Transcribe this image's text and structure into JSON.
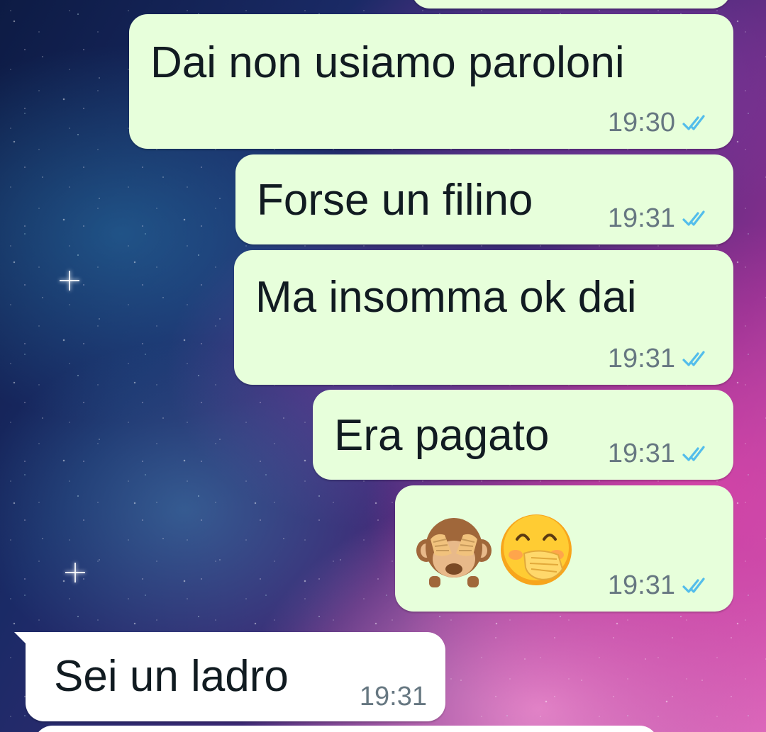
{
  "chat": {
    "messages": [
      {
        "text": "",
        "time": "",
        "direction": "outgoing"
      },
      {
        "text": "Dai non usiamo paroloni",
        "time": "19:30",
        "direction": "outgoing",
        "status": "read"
      },
      {
        "text": "Forse un filino",
        "time": "19:31",
        "direction": "outgoing",
        "status": "read"
      },
      {
        "text": "Ma insomma ok dai",
        "time": "19:31",
        "direction": "outgoing",
        "status": "read"
      },
      {
        "text": "Era pagato",
        "time": "19:31",
        "direction": "outgoing",
        "status": "read"
      },
      {
        "emojis": [
          "see-no-evil-monkey",
          "face-with-hand-over-mouth"
        ],
        "time": "19:31",
        "direction": "outgoing",
        "status": "read"
      },
      {
        "text": "Sei un ladro",
        "time": "19:31",
        "direction": "incoming"
      }
    ]
  },
  "colors": {
    "outgoing_bubble": "#e7ffdb",
    "incoming_bubble": "#ffffff",
    "read_ticks": "#53bdeb",
    "timestamp": "#667781",
    "text": "#111b21"
  }
}
